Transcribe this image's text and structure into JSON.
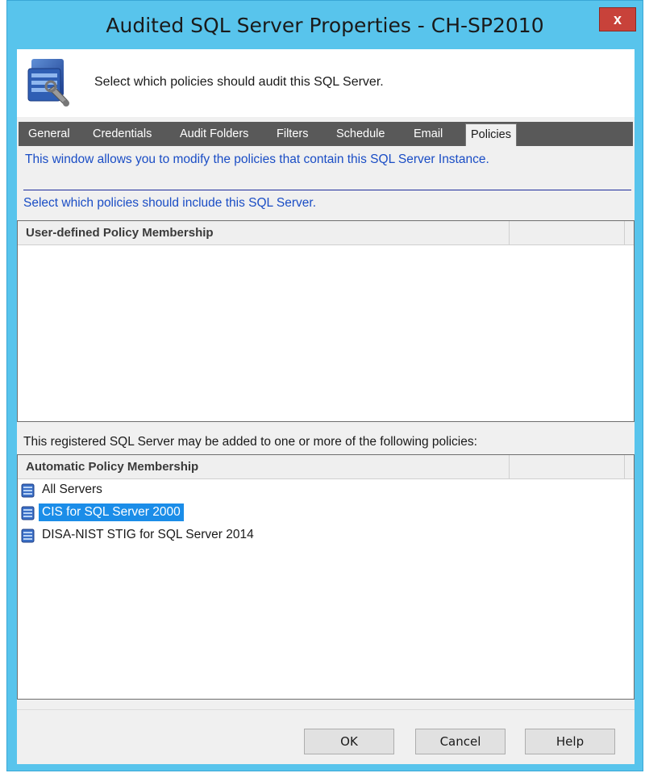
{
  "window": {
    "title": "Audited SQL Server Properties - CH-SP2010",
    "close_label": "x"
  },
  "header": {
    "text": "Select which policies should audit this SQL Server.",
    "icon": "sql-server-wrench-icon"
  },
  "tabs": [
    {
      "label": "General"
    },
    {
      "label": "Credentials"
    },
    {
      "label": "Audit Folders"
    },
    {
      "label": "Filters"
    },
    {
      "label": "Schedule"
    },
    {
      "label": "Email"
    },
    {
      "label": "Policies",
      "active": true
    }
  ],
  "panel": {
    "description": "This window allows you to modify the policies that contain this SQL Server Instance.",
    "select_text": "Select which policies should include this SQL Server.",
    "user_defined_header": "User-defined Policy Membership",
    "auto_text": "This registered SQL Server may be added to one or more of the following policies:",
    "automatic_header": "Automatic Policy Membership",
    "automatic_items": [
      {
        "label": "All Servers",
        "icon": "policy-database-icon"
      },
      {
        "label": "CIS for SQL Server 2000",
        "icon": "policy-database-icon",
        "selected": true
      },
      {
        "label": "DISA-NIST STIG for SQL Server 2014",
        "icon": "policy-database-icon"
      }
    ]
  },
  "buttons": {
    "ok": "OK",
    "cancel": "Cancel",
    "help": "Help"
  },
  "colors": {
    "title_bar": "#58c4ec",
    "close": "#c8423a",
    "tab_strip": "#595959",
    "link_text": "#1a4dc5",
    "selection": "#1b8de8"
  }
}
